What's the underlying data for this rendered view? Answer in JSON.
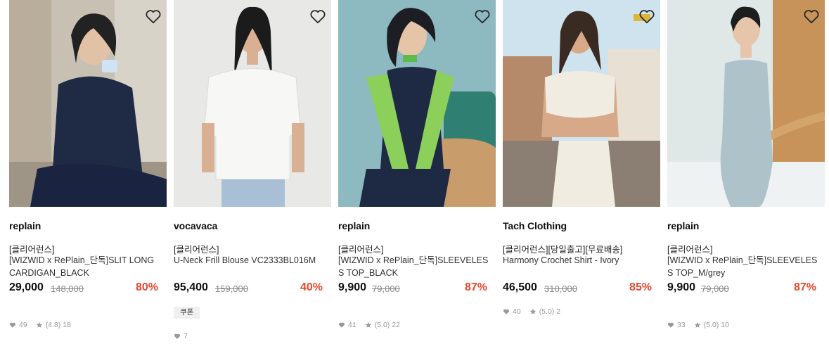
{
  "products": [
    {
      "brand": "replain",
      "tag": "[클리어런스]",
      "name": "[WIZWID x RePlain_단독]SLIT LONG CARDIGAN_BLACK",
      "price": "29,000",
      "original_price": "148,000",
      "discount": "80%",
      "coupon": "",
      "likes": "49",
      "rating": "(4.8)",
      "reviews": "18",
      "photo": {
        "bg": "#c9c2b5",
        "accent": "#1f2a44",
        "skin": "#e2c2a6"
      }
    },
    {
      "brand": "vocavaca",
      "tag": "[클리어런스]",
      "name": "U-Neck Frill Blouse VC2333BL016M",
      "price": "95,400",
      "original_price": "159,000",
      "discount": "40%",
      "coupon": "쿠폰",
      "likes": "7",
      "rating": "",
      "reviews": "",
      "photo": {
        "bg": "#e9e9e7",
        "accent": "#f7f7f5",
        "skin": "#d9b093"
      }
    },
    {
      "brand": "replain",
      "tag": "[클리어런스]",
      "name": "[WIZWID x RePlain_단독]SLEEVELESS TOP_BLACK",
      "price": "9,900",
      "original_price": "79,000",
      "discount": "87%",
      "coupon": "",
      "likes": "41",
      "rating": "(5.0)",
      "reviews": "22",
      "photo": {
        "bg": "#88b8c0",
        "accent": "#1e2a44",
        "skin": "#e6c4a8"
      }
    },
    {
      "brand": "Tach Clothing",
      "tag": "[클리어런스][당일출고][무료배송]",
      "name": "Harmony Crochet Shirt - Ivory",
      "price": "46,500",
      "original_price": "310,000",
      "discount": "85%",
      "coupon": "",
      "likes": "40",
      "rating": "(5.0)",
      "reviews": "2",
      "photo": {
        "bg": "#cfe2ee",
        "accent": "#f1ece2",
        "skin": "#d7a988"
      }
    },
    {
      "brand": "replain",
      "tag": "[클리어런스]",
      "name": "[WIZWID x RePlain_단독]SLEEVELESS TOP_M/grey",
      "price": "9,900",
      "original_price": "79,000",
      "discount": "87%",
      "coupon": "",
      "likes": "33",
      "rating": "(5.0)",
      "reviews": "10",
      "photo": {
        "bg": "#dfe6e6",
        "accent": "#aec3c9",
        "skin": "#e6c5aa"
      }
    }
  ],
  "colors": {
    "discount": "#e8472c",
    "text": "#111111",
    "muted": "#999999"
  },
  "icons": {
    "wishlist": "heart-outline-icon",
    "likes": "heart-filled-icon",
    "rating": "star-icon"
  }
}
